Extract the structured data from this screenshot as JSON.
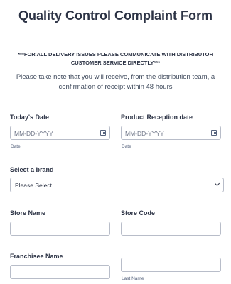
{
  "form": {
    "title": "Quality Control Complaint Form",
    "notice": "***FOR ALL DELIVERY ISSUES PLEASE COMMUNICATE WITH DISTRIBUTOR CUSTOMER SERVICE DIRECTLY***",
    "subtitle": "Please take note that you will receive, from the distribution team, a confirmation of receipt within 48 hours"
  },
  "todays_date": {
    "label": "Today's Date",
    "placeholder": "MM-DD-YYYY",
    "value": "",
    "sublabel": "Date",
    "icon": "calendar-icon"
  },
  "product_reception_date": {
    "label": "Product Reception date",
    "placeholder": "MM-DD-YYYY",
    "value": "",
    "sublabel": "Date",
    "icon": "calendar-icon"
  },
  "brand": {
    "label": "Select a brand",
    "selected": "Please Select",
    "icon": "chevron-down-icon"
  },
  "store_name": {
    "label": "Store Name",
    "value": ""
  },
  "store_code": {
    "label": "Store Code",
    "value": ""
  },
  "franchisee_name": {
    "label": "Franchisee Name",
    "first_value": "",
    "last_value": "",
    "last_sublabel": "Last Name"
  }
}
